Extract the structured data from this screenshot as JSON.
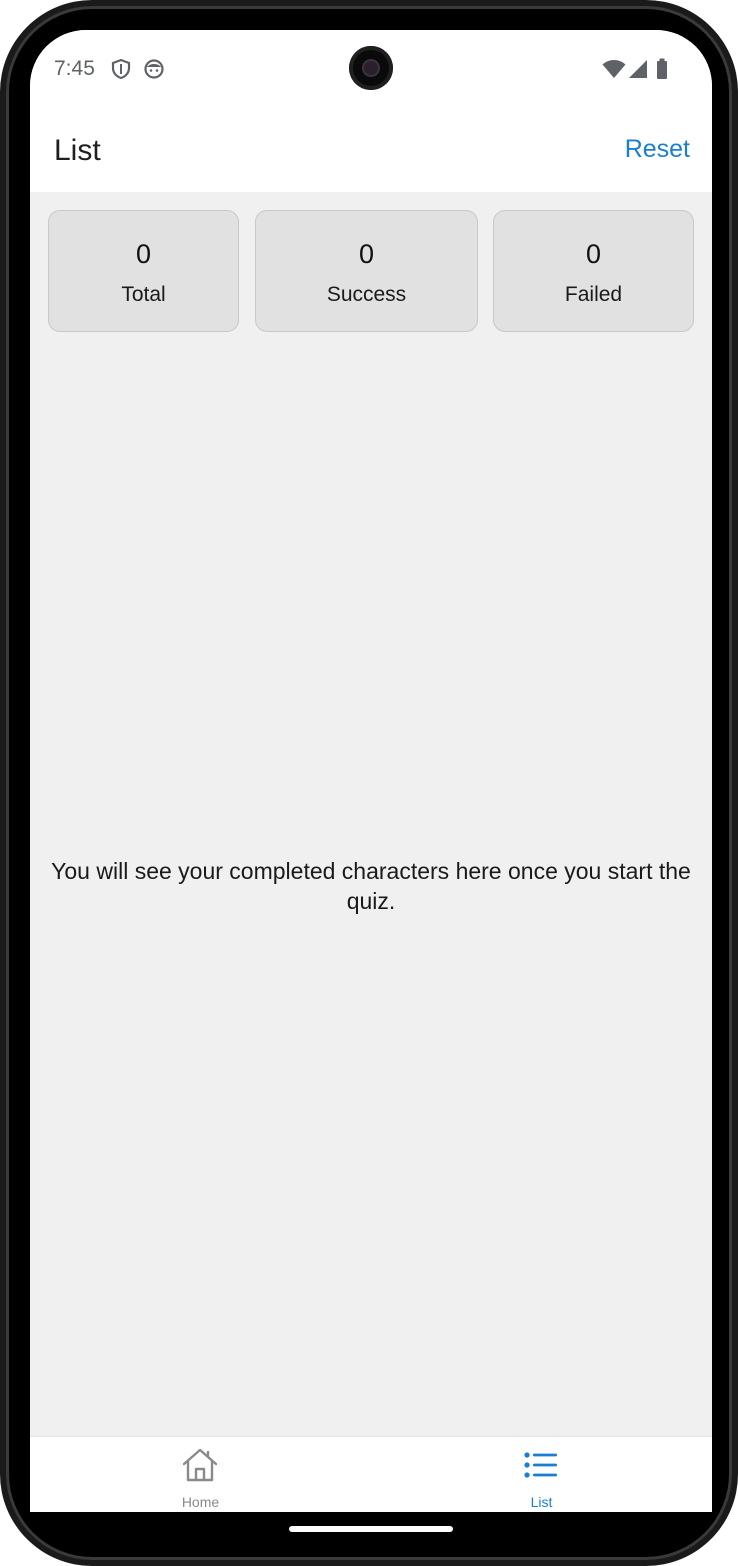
{
  "status_bar": {
    "time": "7:45",
    "left_icons": [
      "shield-icon",
      "face-icon"
    ],
    "right_icons": [
      "wifi-icon",
      "signal-icon",
      "battery-icon"
    ]
  },
  "header": {
    "title": "List",
    "reset_label": "Reset"
  },
  "stats": [
    {
      "value": "0",
      "label": "Total"
    },
    {
      "value": "0",
      "label": "Success"
    },
    {
      "value": "0",
      "label": "Failed"
    }
  ],
  "empty_state": {
    "message": "You will see your completed characters here once you start the quiz."
  },
  "bottom_nav": {
    "items": [
      {
        "label": "Home",
        "icon": "home-icon",
        "active": false
      },
      {
        "label": "List",
        "icon": "list-icon",
        "active": true
      }
    ]
  },
  "colors": {
    "accent": "#1a7fd4",
    "inactive": "#8a8a8a",
    "card_bg": "#e1e1e1",
    "page_bg": "#f0f0f0"
  }
}
